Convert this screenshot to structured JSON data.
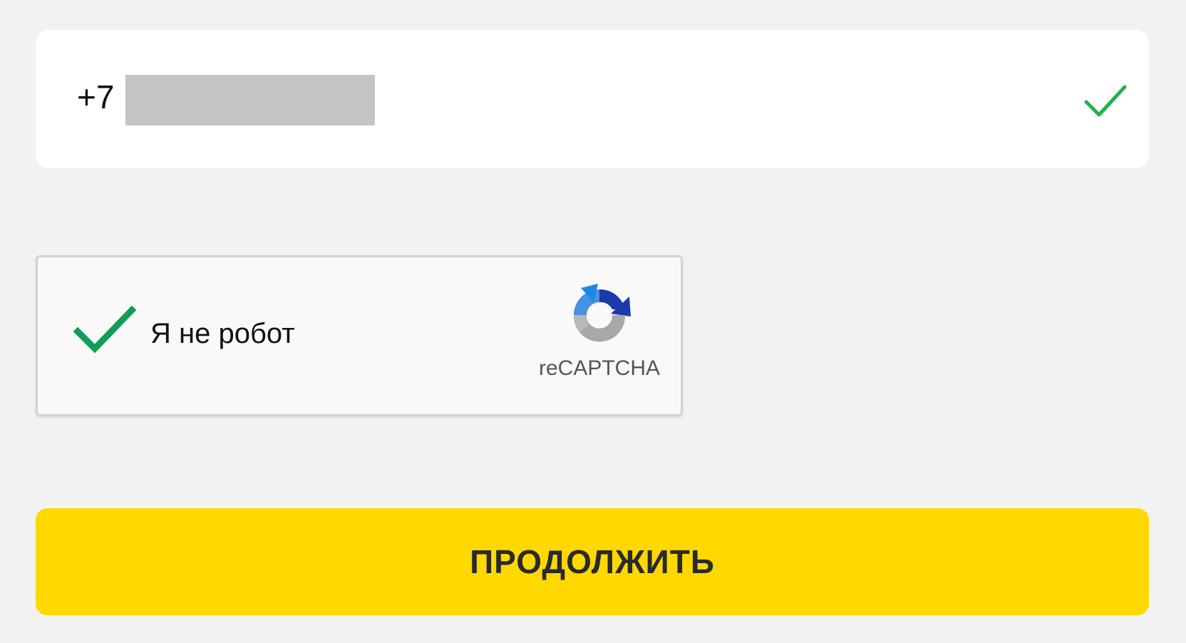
{
  "phone": {
    "prefix": "+7",
    "check_icon": "checkmark-icon",
    "check_color": "#22b14c"
  },
  "recaptcha": {
    "label": "Я не робот",
    "brand": "reCAPTCHA",
    "check_icon": "checkmark-icon",
    "check_color": "#0f9d58",
    "logo_icon": "recaptcha-logo-icon"
  },
  "actions": {
    "continue_label": "ПРОДОЛЖИТЬ",
    "continue_color": "#ffd800"
  }
}
